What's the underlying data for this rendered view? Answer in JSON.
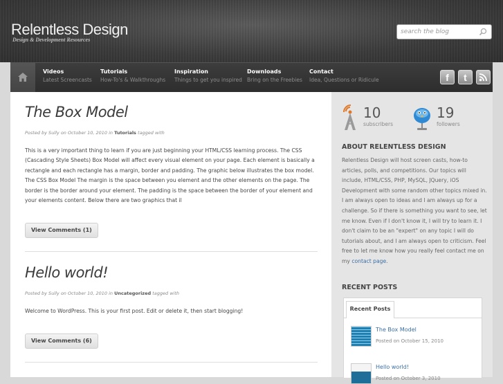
{
  "site": {
    "title": "Relentless Design",
    "tagline": "Design & Development Resources"
  },
  "search": {
    "placeholder": "search the blog",
    "icon": "search-icon"
  },
  "nav": {
    "home_icon": "home-icon",
    "items": [
      {
        "title": "Videos",
        "subtitle": "Latest Screencasts"
      },
      {
        "title": "Tutorials",
        "subtitle": "How-To's & Walkthroughs"
      },
      {
        "title": "Inspiration",
        "subtitle": "Things to get you inspired"
      },
      {
        "title": "Downloads",
        "subtitle": "Bring on the Freebies"
      },
      {
        "title": "Contact",
        "subtitle": "Idea, Questions or Ridicule"
      }
    ],
    "social": [
      {
        "icon": "facebook-icon",
        "glyph": "f"
      },
      {
        "icon": "twitter-icon",
        "glyph": "t"
      },
      {
        "icon": "rss-icon",
        "glyph": ""
      }
    ]
  },
  "posts": [
    {
      "title": "The Box Model",
      "meta_prefix": "Posted by Sully on October 10, 2010 in",
      "category": "Tutorials",
      "meta_suffix": "tagged with",
      "excerpt": "This is a very important thing to learn if you are just beginning your HTML/CSS learning process. The CSS (Cascading Style Sheets) Box Model will affect every visual element on your page. Each element is basically a rectangle and each rectangle has a margin, border and padding. The graphic below illustrates the box model. The CSS Box Model The margin is the space between you element and the other elements on the page. The border is the border around your element. The padding is the space between the border of your element and your elements content. Below there are two graphics that il",
      "comments": "View Comments (1)"
    },
    {
      "title": "Hello world!",
      "meta_prefix": "Posted by Sully on October 10, 2010 in",
      "category": "Uncategorized",
      "meta_suffix": "tagged with",
      "excerpt": "Welcome to WordPress. This is your first post. Edit or delete it, then start blogging!",
      "comments": "View Comments (6)"
    }
  ],
  "sidebar": {
    "subscribers": {
      "count": "10",
      "label": "subscribers",
      "icon": "rss-tower-icon"
    },
    "followers": {
      "count": "19",
      "label": "followers",
      "icon": "twitter-bird-icon"
    },
    "about_heading": "ABOUT RELENTLESS DESIGN",
    "about_text": "Relentless Design will host screen casts, how-to articles, polls, and competitions. Our topics will include, HTML/CSS, PHP, MySQL, JQuery, iOS Development with some random other topics mixed in. I am always open to ideas and I am always up for a challenge. So if there is something you want to see, let me know. Even if I don't know it, I will try to learn it. I don't claim to be an \"expert\" on any topic I will do tutorials about, and I am always open to criticism. Feel free to let me know how you really feel contact me on my",
    "about_link": "contact page",
    "about_end": ".",
    "recent_heading": "RECENT POSTS",
    "recent_tab": "Recent Posts",
    "recent": [
      {
        "title": "The Box Model",
        "date": "Posted on October 15, 2010"
      },
      {
        "title": "Hello world!",
        "date": "Posted on October 3, 2010"
      }
    ]
  }
}
